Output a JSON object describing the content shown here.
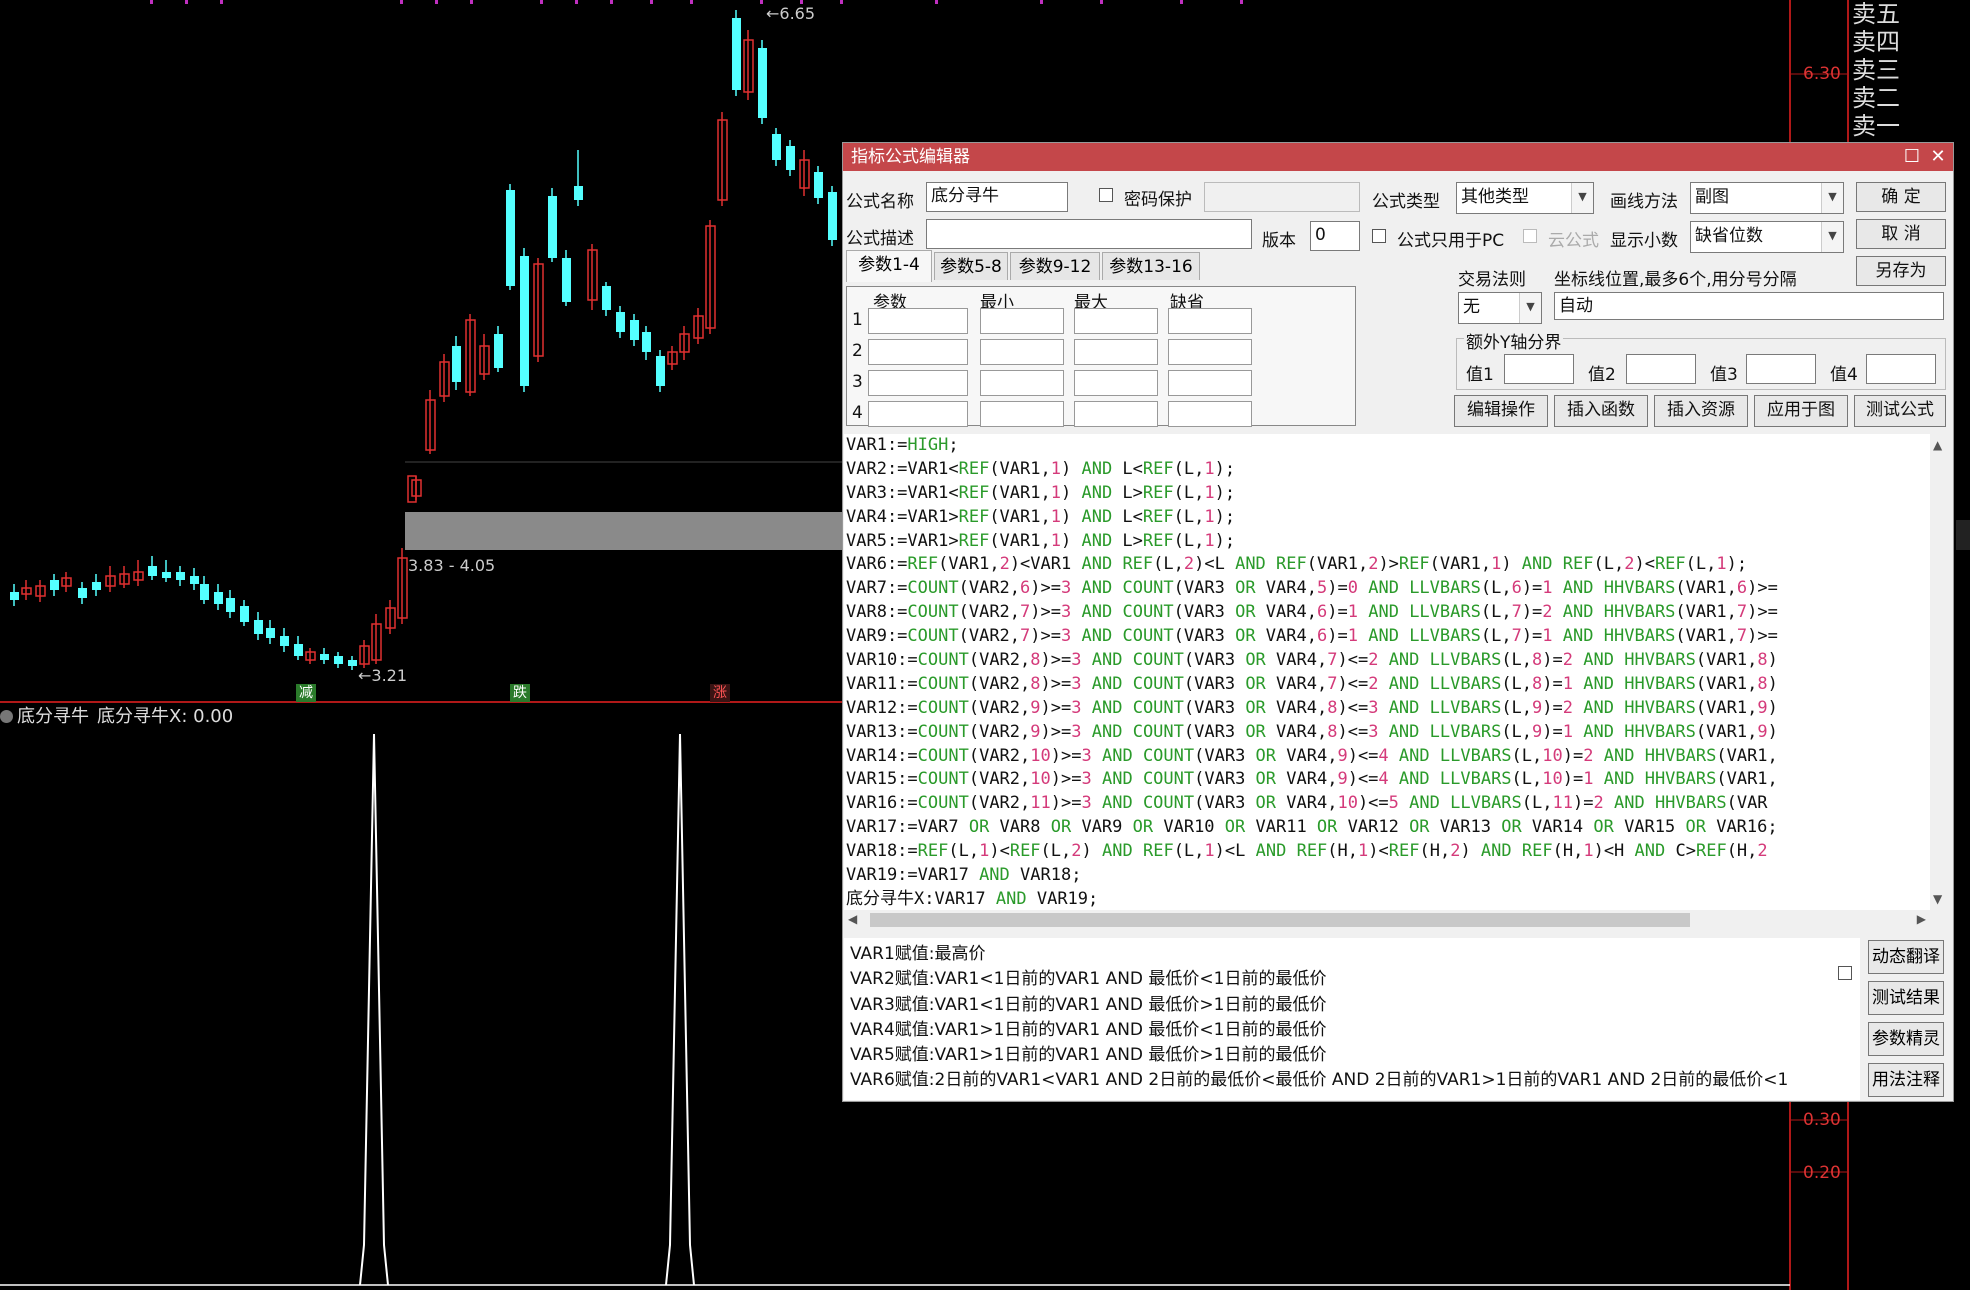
{
  "quote_labels": [
    "卖五",
    "卖四",
    "卖三",
    "卖二",
    "卖一"
  ],
  "price_axis": {
    "p1": "6.30",
    "p2": "0.30",
    "p3": "0.20"
  },
  "price_annotations": {
    "high": "6.65",
    "low": "3.21",
    "range": "3.83 - 4.05"
  },
  "markers": [
    {
      "label": "减",
      "kind": "green"
    },
    {
      "label": "跌",
      "kind": "green"
    },
    {
      "label": "涨",
      "kind": "red"
    }
  ],
  "indicator": {
    "name": "底分寻牛",
    "series": "底分寻牛X: 0.00"
  },
  "dialog": {
    "title": "指标公式编辑器",
    "max_glyph": "☐",
    "close_glyph": "✕",
    "formula_name_label": "公式名称",
    "formula_name": "底分寻牛",
    "password_label": "密码保护",
    "formula_type_label": "公式类型",
    "formula_type": "其他类型",
    "draw_method_label": "画线方法",
    "draw_method": "副图",
    "ok": "确 定",
    "cancel": "取 消",
    "save_as": "另存为",
    "desc_label": "公式描述",
    "version_label": "版本",
    "version": "0",
    "pc_only_label": "公式只用于PC",
    "cloud_label": "云公式",
    "decimals_label": "显示小数",
    "decimals": "缺省位数",
    "tabs": [
      "参数1-4",
      "参数5-8",
      "参数9-12",
      "参数13-16"
    ],
    "param_headers": [
      "参数",
      "最小",
      "最大",
      "缺省"
    ],
    "param_rows": [
      "1",
      "2",
      "3",
      "4"
    ],
    "trade_rule_label": "交易法则",
    "trade_rule": "无",
    "axis_pos_label": "坐标线位置,最多6个,用分号分隔",
    "axis_pos": "自动",
    "extra_y_label": "额外Y轴分界",
    "y_vals": [
      "值1",
      "值2",
      "值3",
      "值4"
    ],
    "actions": [
      "编辑操作",
      "插入函数",
      "插入资源",
      "应用于图",
      "测试公式"
    ],
    "side_actions": [
      "动态翻译",
      "测试结果",
      "参数精灵",
      "用法注释"
    ],
    "code_lines": [
      "VAR1:=HIGH;",
      "VAR2:=VAR1<REF(VAR1,1) AND L<REF(L,1);",
      "VAR3:=VAR1<REF(VAR1,1) AND L>REF(L,1);",
      "VAR4:=VAR1>REF(VAR1,1) AND L<REF(L,1);",
      "VAR5:=VAR1>REF(VAR1,1) AND L>REF(L,1);",
      "VAR6:=REF(VAR1,2)<VAR1 AND REF(L,2)<L AND REF(VAR1,2)>REF(VAR1,1) AND REF(L,2)<REF(L,1);",
      "VAR7:=COUNT(VAR2,6)>=3 AND COUNT(VAR3 OR VAR4,5)=0 AND LLVBARS(L,6)=1 AND HHVBARS(VAR1,6)>=",
      "VAR8:=COUNT(VAR2,7)>=3 AND COUNT(VAR3 OR VAR4,6)=1 AND LLVBARS(L,7)=2 AND HHVBARS(VAR1,7)>=",
      "VAR9:=COUNT(VAR2,7)>=3 AND COUNT(VAR3 OR VAR4,6)=1 AND LLVBARS(L,7)=1 AND HHVBARS(VAR1,7)>=",
      "VAR10:=COUNT(VAR2,8)>=3 AND COUNT(VAR3 OR VAR4,7)<=2 AND LLVBARS(L,8)=2 AND HHVBARS(VAR1,8)",
      "VAR11:=COUNT(VAR2,8)>=3 AND COUNT(VAR3 OR VAR4,7)<=2 AND LLVBARS(L,8)=1 AND HHVBARS(VAR1,8)",
      "VAR12:=COUNT(VAR2,9)>=3 AND COUNT(VAR3 OR VAR4,8)<=3 AND LLVBARS(L,9)=2 AND HHVBARS(VAR1,9)",
      "VAR13:=COUNT(VAR2,9)>=3 AND COUNT(VAR3 OR VAR4,8)<=3 AND LLVBARS(L,9)=1 AND HHVBARS(VAR1,9)",
      "VAR14:=COUNT(VAR2,10)>=3 AND COUNT(VAR3 OR VAR4,9)<=4 AND LLVBARS(L,10)=2 AND HHVBARS(VAR1,",
      "VAR15:=COUNT(VAR2,10)>=3 AND COUNT(VAR3 OR VAR4,9)<=4 AND LLVBARS(L,10)=1 AND HHVBARS(VAR1,",
      "VAR16:=COUNT(VAR2,11)>=3 AND COUNT(VAR3 OR VAR4,10)<=5 AND LLVBARS(L,11)=2 AND HHVBARS(VAR",
      "VAR17:=VAR7 OR VAR8 OR VAR9 OR VAR10 OR VAR11 OR VAR12 OR VAR13 OR VAR14 OR VAR15 OR VAR16;",
      "VAR18:=REF(L,1)<REF(L,2) AND REF(L,1)<L AND REF(H,1)<REF(H,2) AND REF(H,1)<H AND C>REF(H,2",
      "VAR19:=VAR17 AND VAR18;",
      "底分寻牛X:VAR17 AND VAR19;"
    ],
    "notes": [
      "VAR1赋值:最高价",
      "VAR2赋值:VAR1<1日前的VAR1 AND 最低价<1日前的最低价",
      "VAR3赋值:VAR1<1日前的VAR1 AND 最低价>1日前的最低价",
      "VAR4赋值:VAR1>1日前的VAR1 AND 最低价<1日前的最低价",
      "VAR5赋值:VAR1>1日前的VAR1 AND 最低价>1日前的最低价",
      "VAR6赋值:2日前的VAR1<VAR1 AND 2日前的最低价<最低价 AND 2日前的VAR1>1日前的VAR1 AND 2日前的最低价<1"
    ]
  }
}
